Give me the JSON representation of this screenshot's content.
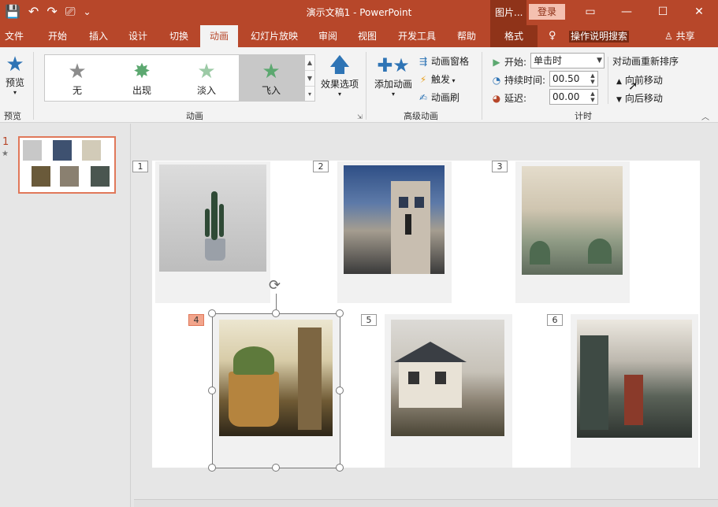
{
  "titlebar": {
    "qat": {
      "save_icon": "💾",
      "undo_icon": "↶",
      "redo_icon": "↷",
      "present_icon": "⎚",
      "customize_icon": "⌄"
    },
    "title": "演示文稿1  -  PowerPoint",
    "context_tab": "图片...",
    "login": "登录",
    "ribbon_display": "▭",
    "minimize": "—",
    "maximize": "☐",
    "close": "✕"
  },
  "tabs": [
    "文件",
    "开始",
    "插入",
    "设计",
    "切换",
    "动画",
    "幻灯片放映",
    "审阅",
    "视图",
    "开发工具",
    "帮助",
    "格式"
  ],
  "tellme": {
    "icon": "♀",
    "label": "操作说明搜索"
  },
  "share": {
    "icon": "♙",
    "label": "共享"
  },
  "ribbon": {
    "preview": {
      "label": "预览",
      "group": "预览"
    },
    "animation_group": "动画",
    "gallery": [
      {
        "label": "无",
        "icon": "★",
        "color": "#8c8c8c"
      },
      {
        "label": "出现",
        "icon": "✸",
        "color": "#5ca870"
      },
      {
        "label": "淡入",
        "icon": "★",
        "color": "#9ccaa6"
      },
      {
        "label": "飞入",
        "icon": "★",
        "color": "#5ca870"
      }
    ],
    "effect_options": "效果选项",
    "advanced_group": "高级动画",
    "add_animation": "添加动画",
    "animation_pane": "动画窗格",
    "trigger": "触发",
    "animation_painter": "动画刷",
    "timing_group": "计时",
    "start_label": "开始:",
    "start_value": "单击时",
    "duration_label": "持续时间:",
    "duration_value": "00.50",
    "delay_label": "延迟:",
    "delay_value": "00.00",
    "reorder": "对动画重新排序",
    "move_earlier": "向前移动",
    "move_later": "向后移动"
  },
  "thumbs": {
    "slide_number": "1",
    "anim_marker": "★"
  },
  "slide": {
    "tags": [
      "1",
      "2",
      "3",
      "4",
      "5",
      "6"
    ],
    "selected": 4
  },
  "colors": {
    "accent": "#b7472a",
    "selected_tag": "#f2a58c"
  }
}
